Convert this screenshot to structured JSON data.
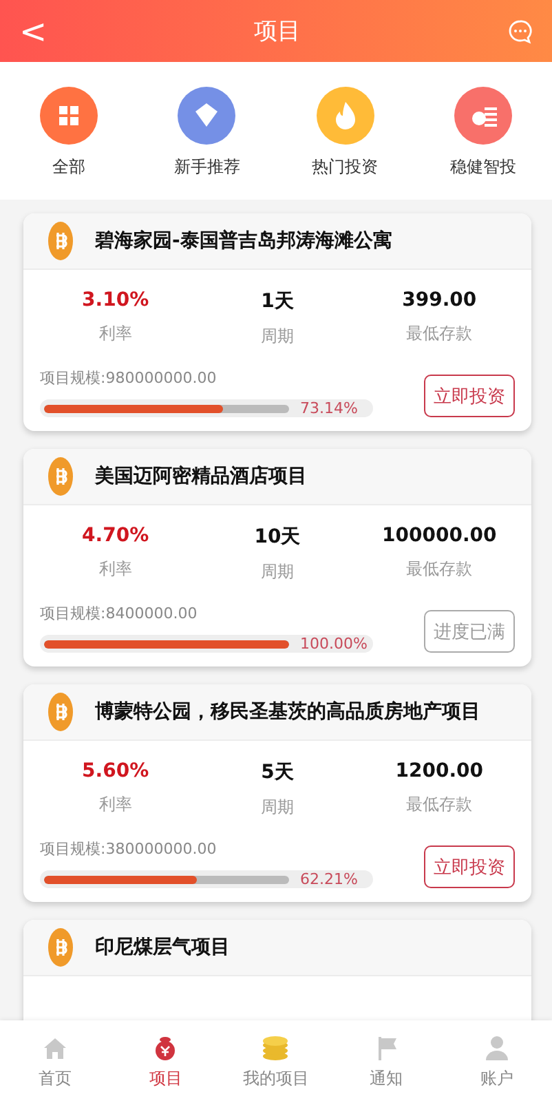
{
  "header": {
    "back": "<",
    "title": "项目"
  },
  "categories": [
    {
      "label": "全部",
      "kind": "grid"
    },
    {
      "label": "新手推荐",
      "kind": "diamond"
    },
    {
      "label": "热门投资",
      "kind": "flame"
    },
    {
      "label": "稳健智投",
      "kind": "coins"
    }
  ],
  "projects": [
    {
      "title": "碧海家园-泰国普吉岛邦涛海滩公寓",
      "rate": "3.10%",
      "rate_label": "利率",
      "period": "1天",
      "period_label": "周期",
      "min": "399.00",
      "min_label": "最低存款",
      "scale": "项目规模:980000000.00",
      "level": 0.7314,
      "percent": "73.14%",
      "button": "立即投资",
      "disabled": false
    },
    {
      "title": "美国迈阿密精品酒店项目",
      "rate": "4.70%",
      "rate_label": "利率",
      "period": "10天",
      "period_label": "周期",
      "min": "100000.00",
      "min_label": "最低存款",
      "scale": "项目规模:8400000.00",
      "level": 1,
      "percent": "100.00%",
      "button": "进度已满",
      "disabled": true
    },
    {
      "title": "博蒙特公园，移民圣基茨的高品质房地产项目",
      "rate": "5.60%",
      "rate_label": "利率",
      "period": "5天",
      "period_label": "周期",
      "min": "1200.00",
      "min_label": "最低存款",
      "scale": "项目规模:380000000.00",
      "level": 0.6221,
      "percent": "62.21%",
      "button": "立即投资",
      "disabled": false
    },
    {
      "title": "印尼煤层气项目"
    }
  ],
  "tabbar": [
    {
      "label": "首页",
      "kind": "home",
      "selected": false
    },
    {
      "label": "项目",
      "kind": "bag",
      "selected": true
    },
    {
      "label": "我的项目",
      "kind": "coins",
      "selected": false
    },
    {
      "label": "通知",
      "kind": "flag",
      "selected": false
    },
    {
      "label": "账户",
      "kind": "user",
      "selected": false
    }
  ]
}
